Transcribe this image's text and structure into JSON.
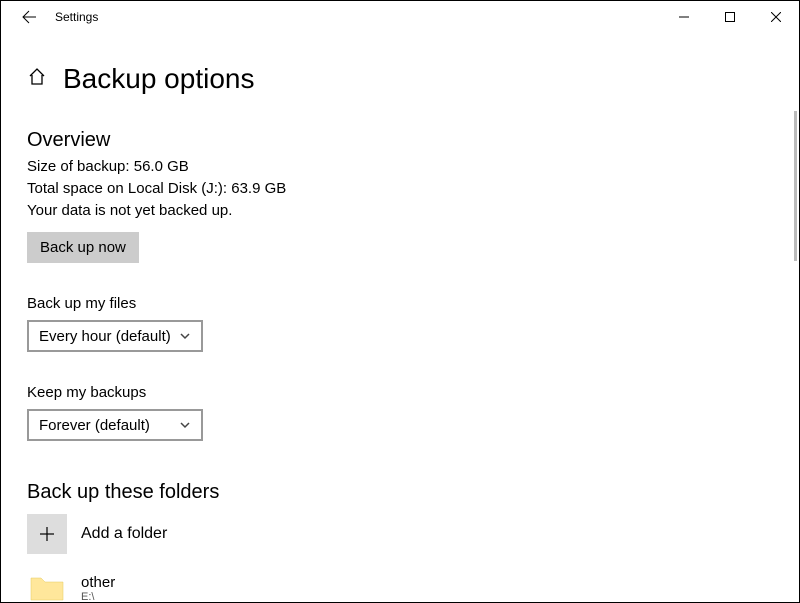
{
  "titlebar": {
    "app_name": "Settings"
  },
  "page": {
    "title": "Backup options"
  },
  "overview": {
    "heading": "Overview",
    "size_line": "Size of backup: 56.0 GB",
    "space_line": "Total space on Local Disk (J:): 63.9 GB",
    "status_line": "Your data is not yet backed up.",
    "backup_button": "Back up now"
  },
  "frequency": {
    "label": "Back up my files",
    "value": "Every hour (default)"
  },
  "retention": {
    "label": "Keep my backups",
    "value": "Forever (default)"
  },
  "folders": {
    "heading": "Back up these folders",
    "add_label": "Add a folder",
    "items": [
      {
        "name": "other",
        "path": "E:\\"
      }
    ]
  }
}
